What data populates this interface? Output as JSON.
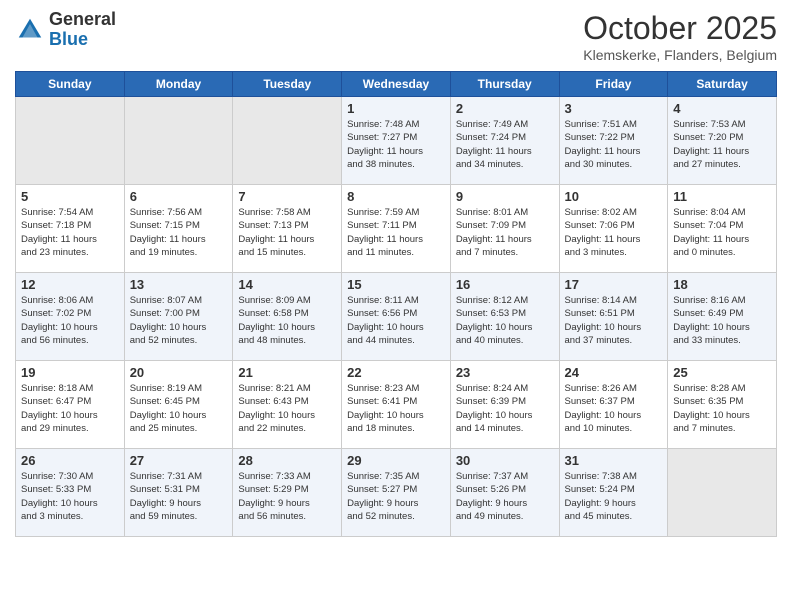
{
  "header": {
    "logo_general": "General",
    "logo_blue": "Blue",
    "month": "October 2025",
    "location": "Klemskerke, Flanders, Belgium"
  },
  "days_of_week": [
    "Sunday",
    "Monday",
    "Tuesday",
    "Wednesday",
    "Thursday",
    "Friday",
    "Saturday"
  ],
  "weeks": [
    [
      {
        "day": "",
        "info": ""
      },
      {
        "day": "",
        "info": ""
      },
      {
        "day": "",
        "info": ""
      },
      {
        "day": "1",
        "info": "Sunrise: 7:48 AM\nSunset: 7:27 PM\nDaylight: 11 hours\nand 38 minutes."
      },
      {
        "day": "2",
        "info": "Sunrise: 7:49 AM\nSunset: 7:24 PM\nDaylight: 11 hours\nand 34 minutes."
      },
      {
        "day": "3",
        "info": "Sunrise: 7:51 AM\nSunset: 7:22 PM\nDaylight: 11 hours\nand 30 minutes."
      },
      {
        "day": "4",
        "info": "Sunrise: 7:53 AM\nSunset: 7:20 PM\nDaylight: 11 hours\nand 27 minutes."
      }
    ],
    [
      {
        "day": "5",
        "info": "Sunrise: 7:54 AM\nSunset: 7:18 PM\nDaylight: 11 hours\nand 23 minutes."
      },
      {
        "day": "6",
        "info": "Sunrise: 7:56 AM\nSunset: 7:15 PM\nDaylight: 11 hours\nand 19 minutes."
      },
      {
        "day": "7",
        "info": "Sunrise: 7:58 AM\nSunset: 7:13 PM\nDaylight: 11 hours\nand 15 minutes."
      },
      {
        "day": "8",
        "info": "Sunrise: 7:59 AM\nSunset: 7:11 PM\nDaylight: 11 hours\nand 11 minutes."
      },
      {
        "day": "9",
        "info": "Sunrise: 8:01 AM\nSunset: 7:09 PM\nDaylight: 11 hours\nand 7 minutes."
      },
      {
        "day": "10",
        "info": "Sunrise: 8:02 AM\nSunset: 7:06 PM\nDaylight: 11 hours\nand 3 minutes."
      },
      {
        "day": "11",
        "info": "Sunrise: 8:04 AM\nSunset: 7:04 PM\nDaylight: 11 hours\nand 0 minutes."
      }
    ],
    [
      {
        "day": "12",
        "info": "Sunrise: 8:06 AM\nSunset: 7:02 PM\nDaylight: 10 hours\nand 56 minutes."
      },
      {
        "day": "13",
        "info": "Sunrise: 8:07 AM\nSunset: 7:00 PM\nDaylight: 10 hours\nand 52 minutes."
      },
      {
        "day": "14",
        "info": "Sunrise: 8:09 AM\nSunset: 6:58 PM\nDaylight: 10 hours\nand 48 minutes."
      },
      {
        "day": "15",
        "info": "Sunrise: 8:11 AM\nSunset: 6:56 PM\nDaylight: 10 hours\nand 44 minutes."
      },
      {
        "day": "16",
        "info": "Sunrise: 8:12 AM\nSunset: 6:53 PM\nDaylight: 10 hours\nand 40 minutes."
      },
      {
        "day": "17",
        "info": "Sunrise: 8:14 AM\nSunset: 6:51 PM\nDaylight: 10 hours\nand 37 minutes."
      },
      {
        "day": "18",
        "info": "Sunrise: 8:16 AM\nSunset: 6:49 PM\nDaylight: 10 hours\nand 33 minutes."
      }
    ],
    [
      {
        "day": "19",
        "info": "Sunrise: 8:18 AM\nSunset: 6:47 PM\nDaylight: 10 hours\nand 29 minutes."
      },
      {
        "day": "20",
        "info": "Sunrise: 8:19 AM\nSunset: 6:45 PM\nDaylight: 10 hours\nand 25 minutes."
      },
      {
        "day": "21",
        "info": "Sunrise: 8:21 AM\nSunset: 6:43 PM\nDaylight: 10 hours\nand 22 minutes."
      },
      {
        "day": "22",
        "info": "Sunrise: 8:23 AM\nSunset: 6:41 PM\nDaylight: 10 hours\nand 18 minutes."
      },
      {
        "day": "23",
        "info": "Sunrise: 8:24 AM\nSunset: 6:39 PM\nDaylight: 10 hours\nand 14 minutes."
      },
      {
        "day": "24",
        "info": "Sunrise: 8:26 AM\nSunset: 6:37 PM\nDaylight: 10 hours\nand 10 minutes."
      },
      {
        "day": "25",
        "info": "Sunrise: 8:28 AM\nSunset: 6:35 PM\nDaylight: 10 hours\nand 7 minutes."
      }
    ],
    [
      {
        "day": "26",
        "info": "Sunrise: 7:30 AM\nSunset: 5:33 PM\nDaylight: 10 hours\nand 3 minutes."
      },
      {
        "day": "27",
        "info": "Sunrise: 7:31 AM\nSunset: 5:31 PM\nDaylight: 9 hours\nand 59 minutes."
      },
      {
        "day": "28",
        "info": "Sunrise: 7:33 AM\nSunset: 5:29 PM\nDaylight: 9 hours\nand 56 minutes."
      },
      {
        "day": "29",
        "info": "Sunrise: 7:35 AM\nSunset: 5:27 PM\nDaylight: 9 hours\nand 52 minutes."
      },
      {
        "day": "30",
        "info": "Sunrise: 7:37 AM\nSunset: 5:26 PM\nDaylight: 9 hours\nand 49 minutes."
      },
      {
        "day": "31",
        "info": "Sunrise: 7:38 AM\nSunset: 5:24 PM\nDaylight: 9 hours\nand 45 minutes."
      },
      {
        "day": "",
        "info": ""
      }
    ]
  ]
}
